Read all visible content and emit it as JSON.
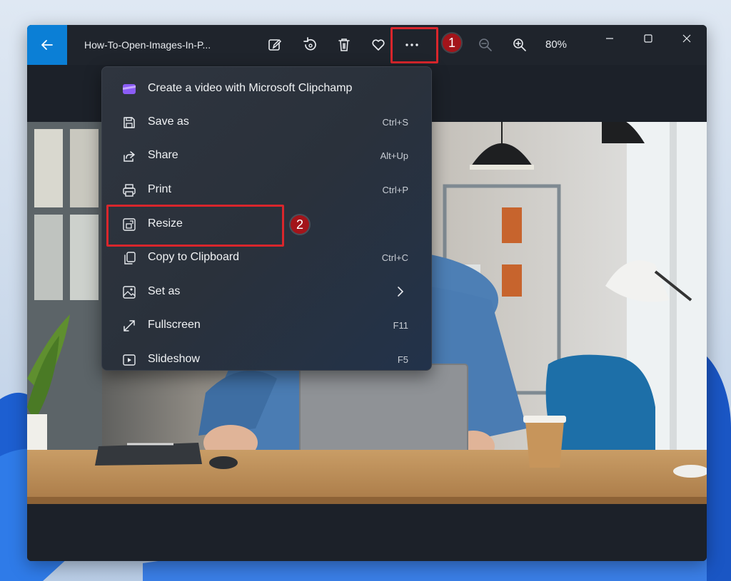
{
  "window": {
    "file_title": "How-To-Open-Images-In-P...",
    "zoom_level": "80%"
  },
  "toolbar": {
    "icons": [
      "edit-image-icon",
      "rotate-icon",
      "delete-icon",
      "favorite-icon",
      "more-options-icon",
      "zoom-out-icon",
      "zoom-in-icon"
    ]
  },
  "annotations": {
    "step1": "1",
    "step2": "2",
    "highlight_color": "#d9262c"
  },
  "menu": {
    "items": [
      {
        "label": "Create a video with Microsoft Clipchamp",
        "shortcut": "",
        "icon": "clipchamp-icon"
      },
      {
        "label": "Save as",
        "shortcut": "Ctrl+S",
        "icon": "save-icon"
      },
      {
        "label": "Share",
        "shortcut": "Alt+Up",
        "icon": "share-icon"
      },
      {
        "label": "Print",
        "shortcut": "Ctrl+P",
        "icon": "print-icon"
      },
      {
        "label": "Resize",
        "shortcut": "",
        "icon": "resize-icon"
      },
      {
        "label": "Copy to Clipboard",
        "shortcut": "Ctrl+C",
        "icon": "copy-icon"
      },
      {
        "label": "Set as",
        "shortcut": "",
        "icon": "set-as-icon"
      },
      {
        "label": "Fullscreen",
        "shortcut": "F11",
        "icon": "fullscreen-icon"
      },
      {
        "label": "Slideshow",
        "shortcut": "F5",
        "icon": "slideshow-icon"
      }
    ]
  },
  "colors": {
    "accent": "#0b7fd6",
    "window_bg": "#1c2129",
    "menu_text": "#f1f3f5"
  }
}
